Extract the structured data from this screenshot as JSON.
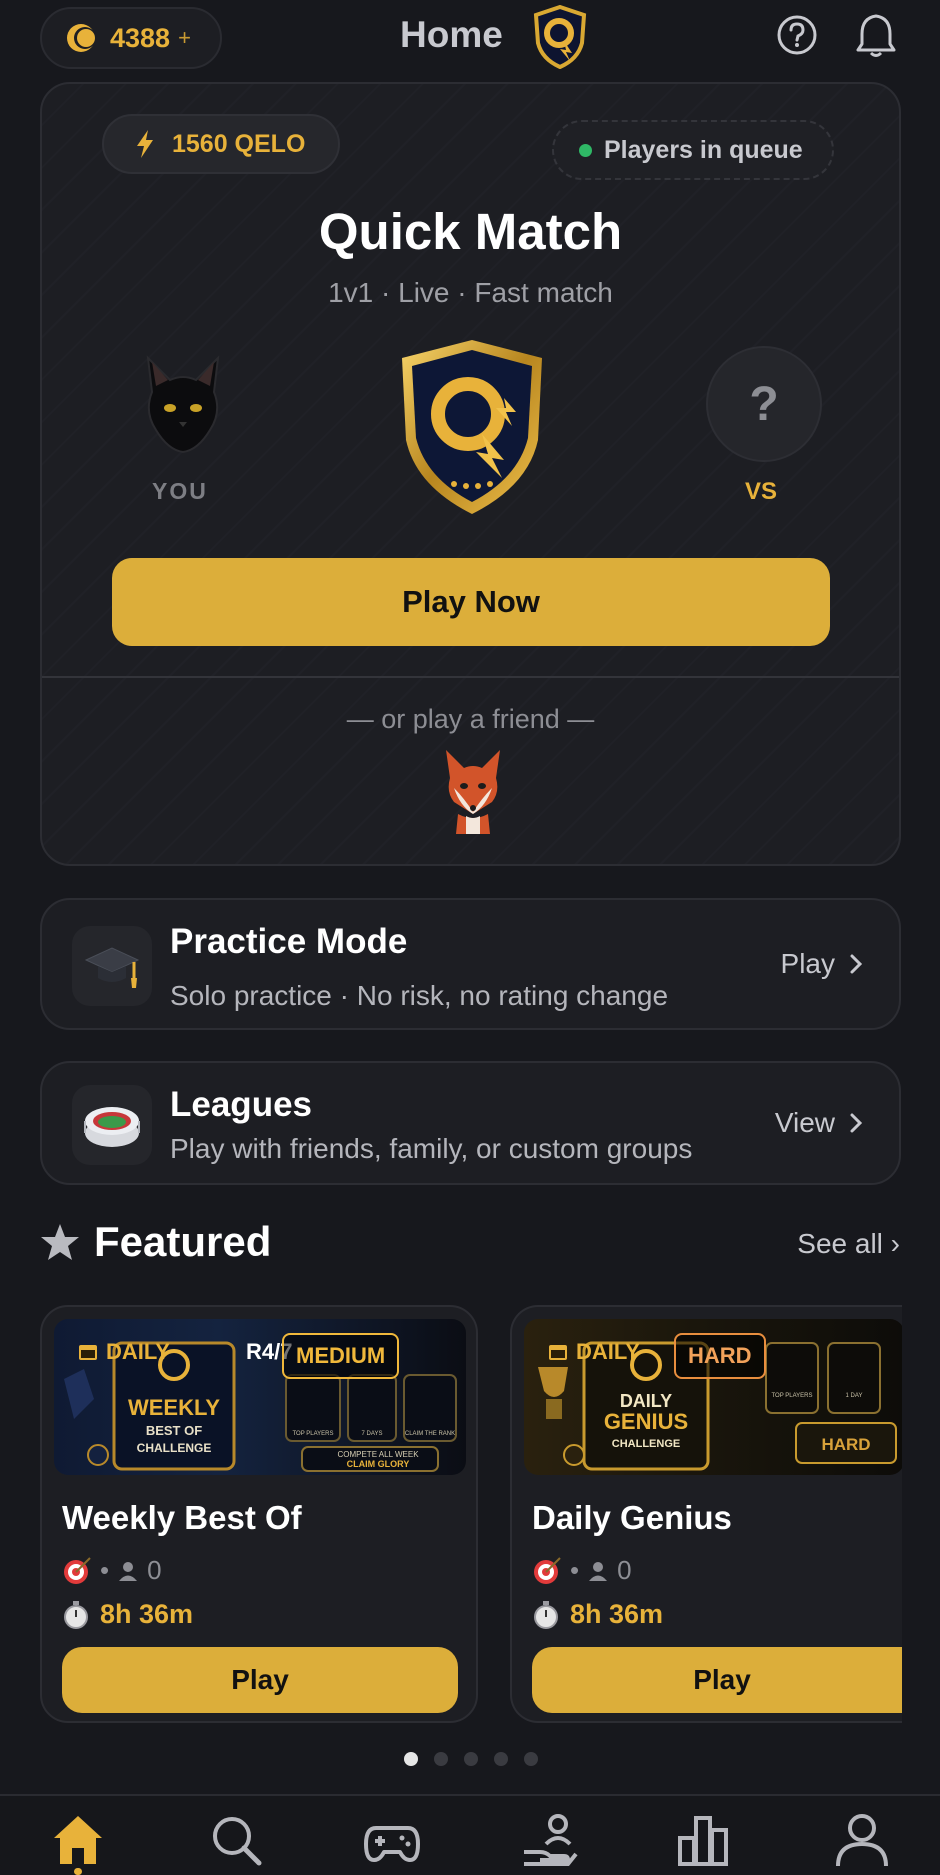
{
  "header": {
    "coins": "4388",
    "coins_plus": "+",
    "title": "Home"
  },
  "quick_match": {
    "rating": "1560 QELO",
    "queue_status": "Players in queue",
    "title": "Quick Match",
    "subtitle": "1v1 · Live · Fast match",
    "you_label": "YOU",
    "opponent_placeholder": "?",
    "vs_label": "VS",
    "play_button": "Play Now",
    "friend_text": "— or play a friend —"
  },
  "practice": {
    "title": "Practice Mode",
    "subtitle": "Solo practice · No risk, no rating change",
    "action": "Play"
  },
  "leagues": {
    "title": "Leagues",
    "subtitle": "Play with friends, family, or custom groups",
    "action": "View"
  },
  "featured": {
    "title": "Featured",
    "see_all": "See all ›",
    "cards": [
      {
        "tag": "DAILY",
        "round": "R4/7",
        "difficulty": "MEDIUM",
        "title": "Weekly Best Of",
        "players_sep": "•",
        "players": "0",
        "timer": "8h 36m",
        "play": "Play"
      },
      {
        "tag": "DAILY",
        "difficulty": "HARD",
        "title": "Daily Genius",
        "players_sep": "•",
        "players": "0",
        "timer": "8h 36m",
        "play": "Play"
      }
    ],
    "pagination": {
      "total": 5,
      "active": 1
    }
  },
  "bottom_nav": {
    "items": [
      "home-icon",
      "search-icon",
      "gamepad-icon",
      "leagues-icon",
      "stats-icon",
      "profile-icon"
    ],
    "active": "home-icon"
  },
  "colors": {
    "accent_gold": "#dcae3a",
    "background": "#17181d",
    "card": "#1d1e23",
    "online_green": "#2fb866"
  }
}
